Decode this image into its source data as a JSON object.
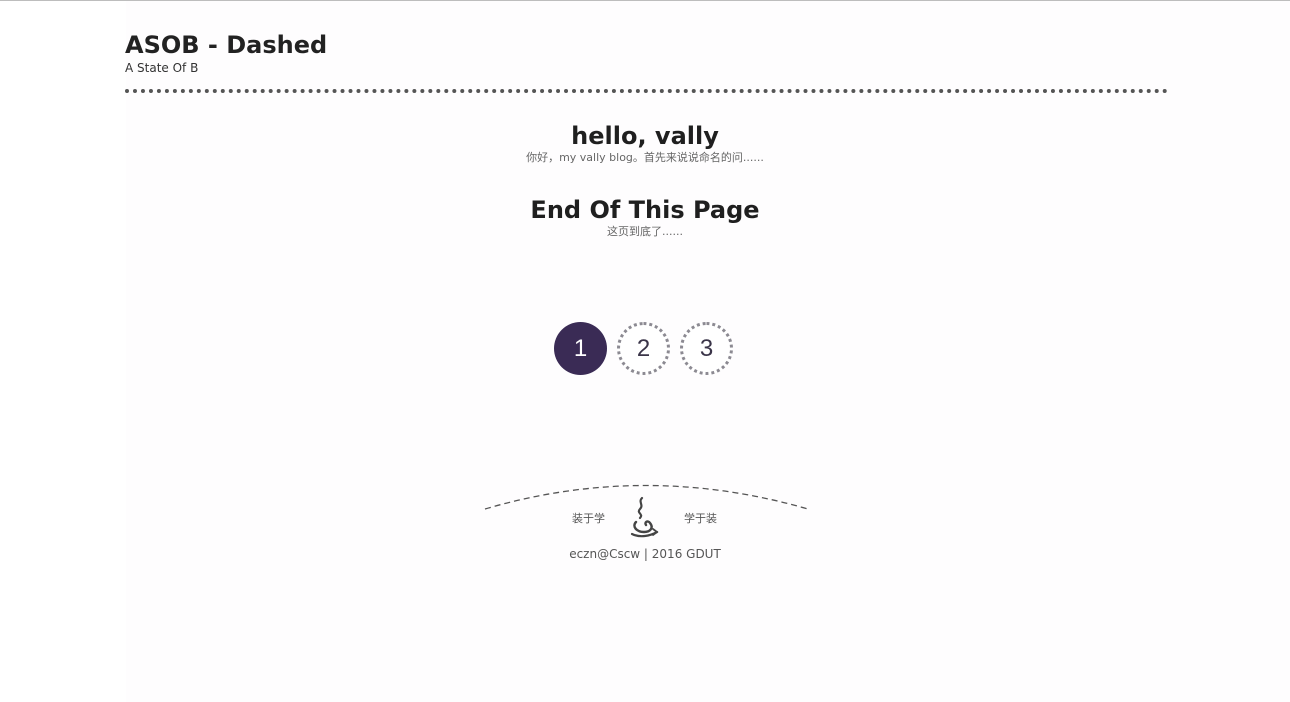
{
  "header": {
    "title": "ASOB - Dashed",
    "subtitle": "A State Of B"
  },
  "posts": [
    {
      "title": "hello, vally",
      "excerpt": "你好，my vally blog。首先来说说命名的问......"
    },
    {
      "title": "End Of This Page",
      "excerpt": "这页到底了......"
    }
  ],
  "pagination": {
    "pages": [
      "1",
      "2",
      "3"
    ],
    "current": "1"
  },
  "footer": {
    "left_link": "装于学",
    "right_link": "学于装",
    "logo_icon": "flame-logo-icon",
    "copyright": "eczn@Cscw | 2016 GDUT"
  },
  "colors": {
    "accent": "#3a2b55",
    "text": "#222222"
  }
}
